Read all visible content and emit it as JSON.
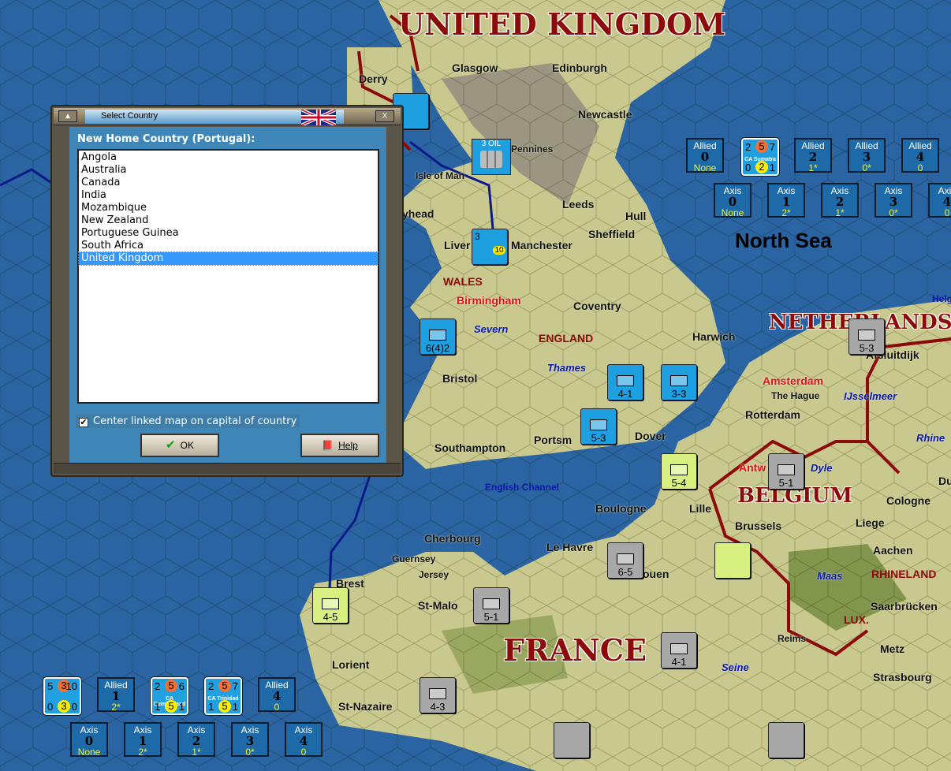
{
  "colors": {
    "sea": "#2b64a3",
    "land": "#c9c88e",
    "border": "#8b0a0a",
    "dialog_body": "#3f86b8",
    "selected": "#3399ff"
  },
  "countries": [
    "UNITED KINGDOM",
    "NETHERLANDS",
    "BELGIUM",
    "FRANCE",
    "WALES",
    "ENGLAND",
    "LUX.",
    "RHINELAND"
  ],
  "cities": [
    "Derry",
    "Glasgow",
    "Edinburgh",
    "Newcastle",
    "Pennines",
    "Isle of Man",
    "yhead",
    "Leeds",
    "Hull",
    "Sheffield",
    "Liver",
    "Manchester",
    "Coventry",
    "Harwich",
    "Bristol",
    "Southampton",
    "Portsm",
    "Dover",
    "Boulogne",
    "Lille",
    "Brussels",
    "Liege",
    "Aachen",
    "Cologne",
    "Cherbourg",
    "Le Havre",
    "ouen",
    "Brest",
    "St-Malo",
    "Lorient",
    "St-Nazaire",
    "Metz",
    "Strasbourg",
    "Saarbrücken",
    "Rotterdam",
    "Afsluitdijk",
    "Du"
  ],
  "small_cities": [
    "Guernsey",
    "Jersey",
    "The Hague",
    "Reims"
  ],
  "red_cities": [
    "Birmingham",
    "Amsterdam",
    "Antw"
  ],
  "rivers": [
    "Severn",
    "Thames",
    "Maas",
    "Seine",
    "Rhine",
    "Dyle",
    "IJsselmeer"
  ],
  "seas": {
    "north": "North Sea",
    "channel": "English Channel",
    "helg": "Helg"
  },
  "oil": "3 OIL",
  "top_boxes": {
    "allied": [
      {
        "side": "Allied",
        "num": "0",
        "sub": "None"
      },
      {
        "side": "Allied",
        "num": "2",
        "sub": "1*"
      },
      {
        "side": "Allied",
        "num": "3",
        "sub": "0*"
      },
      {
        "side": "Allied",
        "num": "4",
        "sub": "0"
      }
    ],
    "axis": [
      {
        "side": "Axis",
        "num": "0",
        "sub": "None"
      },
      {
        "side": "Axis",
        "num": "1",
        "sub": "2*"
      },
      {
        "side": "Axis",
        "num": "2",
        "sub": "1*"
      },
      {
        "side": "Axis",
        "num": "3",
        "sub": "0*"
      },
      {
        "side": "Axis",
        "num": "4",
        "sub": "0"
      }
    ],
    "ship": {
      "tl": "2",
      "oc": "5",
      "tr": "7",
      "name": "CA Sumatra",
      "bl": "0",
      "yc": "2",
      "br": "1"
    }
  },
  "bottom_boxes": {
    "allied": [
      {
        "side": "Allied",
        "num": "1",
        "sub": "2*"
      },
      {
        "side": "Allied",
        "num": "4",
        "sub": "0"
      }
    ],
    "axis": [
      {
        "side": "Axis",
        "num": "0",
        "sub": "None"
      },
      {
        "side": "Axis",
        "num": "1",
        "sub": "2*"
      },
      {
        "side": "Axis",
        "num": "2",
        "sub": "1*"
      },
      {
        "side": "Axis",
        "num": "3",
        "sub": "0*"
      },
      {
        "side": "Axis",
        "num": "4",
        "sub": "0"
      }
    ],
    "ships": [
      {
        "tl": "5",
        "oc": "3",
        "tr": "10",
        "name": "",
        "bl": "0",
        "yc": "3",
        "br": "0"
      },
      {
        "tl": "2",
        "oc": "5",
        "tr": "6",
        "name": "CA Cumberland",
        "bl": "1",
        "yc": "5",
        "br": "1"
      },
      {
        "tl": "2",
        "oc": "5",
        "tr": "7",
        "name": "CA Trinidad",
        "bl": "1",
        "yc": "5",
        "br": "1"
      }
    ]
  },
  "units": [
    {
      "v": "6(4)2"
    },
    {
      "v": "4-1"
    },
    {
      "v": "3-3"
    },
    {
      "v": "5-3"
    },
    {
      "v": "5-4"
    },
    {
      "v": "5-1"
    },
    {
      "v": "5-3"
    },
    {
      "v": "6-5"
    },
    {
      "v": "4-5"
    },
    {
      "v": "5-1"
    },
    {
      "v": "4-1"
    },
    {
      "v": "4-3"
    },
    {
      "v": "3"
    },
    {
      "v": "10"
    }
  ],
  "dialog": {
    "title": "Select Country",
    "heading": "New Home Country (Portugal):",
    "items": [
      "Angola",
      "Australia",
      "Canada",
      "India",
      "Mozambique",
      "New Zealand",
      "Portuguese Guinea",
      "South Africa",
      "United Kingdom"
    ],
    "selected": "United Kingdom",
    "checkbox_label": "Center linked map on capital of country",
    "checkbox_mark": "✔",
    "ok_label": "OK",
    "ok_icon": "✔",
    "help_label": "Help",
    "help_icon": "📕",
    "minimize": "▲",
    "close": "X"
  }
}
